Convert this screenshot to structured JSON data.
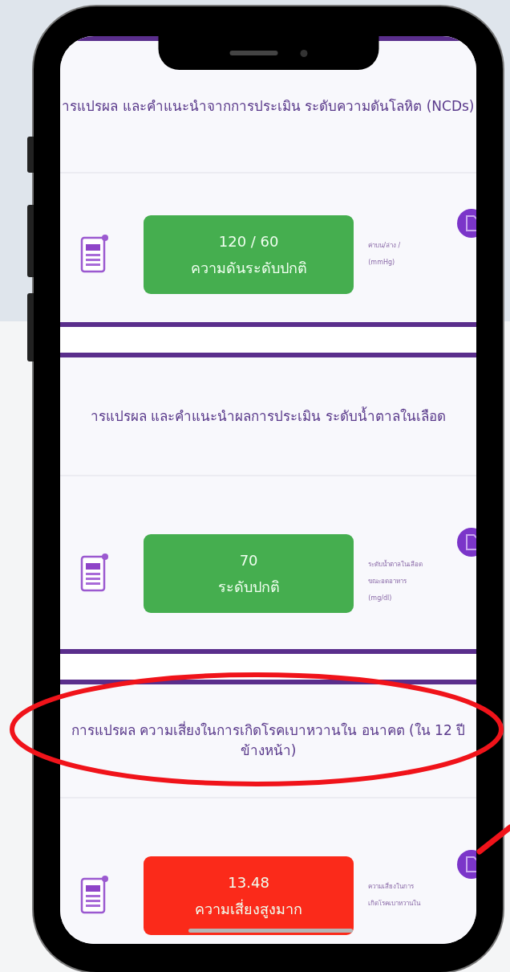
{
  "sections": [
    {
      "title": "ารแปรผล และคำแนะนำจากการประเมิน ระดับความดันโลหิต (NCDs)",
      "result": {
        "value": "120 / 60",
        "label": "ความดันระดับปกติ",
        "color": "#45ae4f"
      },
      "unit": [
        "ค่าบน/ล่าง /",
        "(mmHg)"
      ]
    },
    {
      "title": "ารแปรผล และคำแนะนำผลการประเมิน ระดับน้ำตาลในเลือด",
      "result": {
        "value": "70",
        "label": "ระดับปกติ",
        "color": "#45ae4f"
      },
      "unit": [
        "ระดับน้ำตาลในเลือด",
        "ขณะอดอาหาร",
        "(mg/dl)"
      ]
    },
    {
      "title": "การแปรผล ความเสี่ยงในการเกิดโรคเบาหวานใน อนาคต (ใน 12 ปีข้างหน้า)",
      "result": {
        "value": "13.48",
        "label": "ความเสี่ยงสูงมาก",
        "color": "#fb2a1a"
      },
      "unit": [
        "ความเสี่ยงในการ",
        "เกิดโรคเบาหวานใน"
      ]
    }
  ],
  "annotations": {
    "highlight_ellipse": true,
    "pointer_line": true
  }
}
